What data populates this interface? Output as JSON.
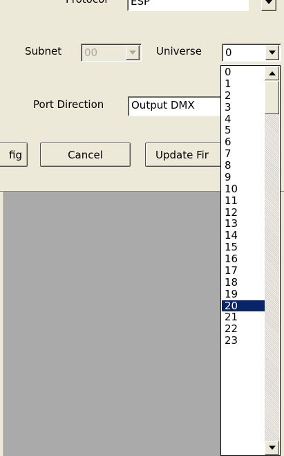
{
  "protocol": {
    "label": "Protocol",
    "value": "ESP"
  },
  "subnet": {
    "label": "Subnet",
    "value": "00"
  },
  "universe": {
    "label": "Universe",
    "value": "0",
    "options": [
      "0",
      "1",
      "2",
      "3",
      "4",
      "5",
      "6",
      "7",
      "8",
      "9",
      "10",
      "11",
      "12",
      "13",
      "14",
      "15",
      "16",
      "17",
      "18",
      "19",
      "20",
      "21",
      "22",
      "23"
    ],
    "highlighted": "20"
  },
  "port_direction": {
    "label": "Port Direction",
    "value": "Output DMX"
  },
  "buttons": {
    "config": "fig",
    "cancel": "Cancel",
    "update_firmware": "Update Fir"
  },
  "colors": {
    "selection": "#0a246a",
    "dialog_bg": "#ece9d8",
    "backdrop": "#aaaaaa"
  }
}
